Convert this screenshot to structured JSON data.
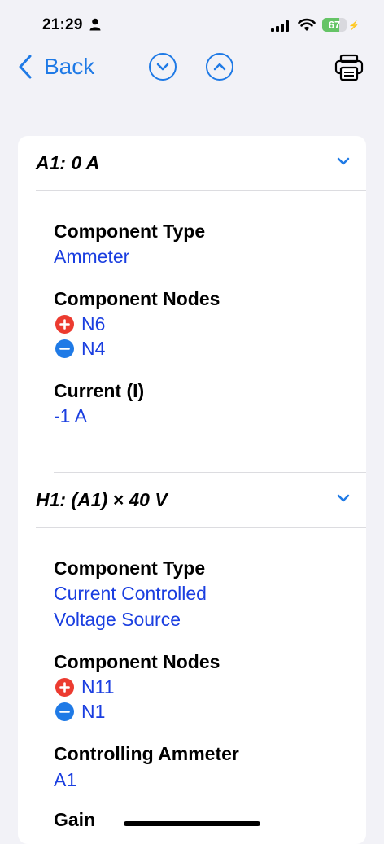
{
  "status": {
    "time": "21:29",
    "battery": "67"
  },
  "nav": {
    "back_label": "Back"
  },
  "sections": [
    {
      "title": "A1: 0 A",
      "type_label": "Component Type",
      "type_value": "Ammeter",
      "nodes_label": "Component Nodes",
      "node_pos": "N6",
      "node_neg": "N4",
      "current_label": "Current (I)",
      "current_value": "-1 A"
    },
    {
      "title": "H1: (A1) × 40 V",
      "type_label": "Component Type",
      "type_value_line1": "Current Controlled",
      "type_value_line2": "Voltage Source",
      "nodes_label": "Component Nodes",
      "node_pos": "N11",
      "node_neg": "N1",
      "ammeter_label": "Controlling Ammeter",
      "ammeter_value": "A1",
      "gain_label": "Gain"
    }
  ],
  "colors": {
    "accent": "#1f7ae6",
    "value": "#1a3ee0",
    "plus": "#ec3b30",
    "minus": "#1f7ae6"
  }
}
